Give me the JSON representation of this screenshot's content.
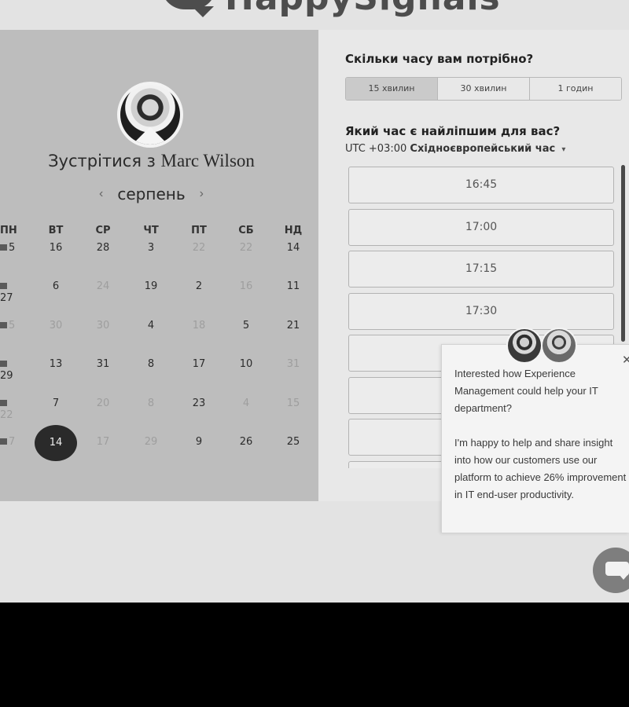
{
  "brand": {
    "name": "HappySignals",
    "logo_icon": "speech-bubble-logo"
  },
  "host": {
    "prefix": "Зустрітися з",
    "name": "Marc Wilson"
  },
  "calendar": {
    "month": "серпень",
    "prev_icon": "‹",
    "next_icon": "›",
    "weekdays": [
      "ПН",
      "ВТ",
      "СР",
      "ЧТ",
      "ПТ",
      "СБ",
      "НД"
    ],
    "weeks": [
      [
        {
          "d": "5",
          "dim": false
        },
        {
          "d": "16",
          "dim": false
        },
        {
          "d": "28",
          "dim": false
        },
        {
          "d": "3",
          "dim": false
        },
        {
          "d": "22",
          "dim": true
        },
        {
          "d": "22",
          "dim": true
        },
        {
          "d": "14",
          "dim": false
        }
      ],
      [
        {
          "d": "27",
          "dim": false
        },
        {
          "d": "6",
          "dim": false
        },
        {
          "d": "24",
          "dim": true
        },
        {
          "d": "19",
          "dim": false
        },
        {
          "d": "2",
          "dim": false
        },
        {
          "d": "16",
          "dim": true
        },
        {
          "d": "11",
          "dim": false
        }
      ],
      [
        {
          "d": "5",
          "dim": true
        },
        {
          "d": "30",
          "dim": true
        },
        {
          "d": "30",
          "dim": true
        },
        {
          "d": "4",
          "dim": false
        },
        {
          "d": "18",
          "dim": true
        },
        {
          "d": "5",
          "dim": false
        },
        {
          "d": "21",
          "dim": false
        }
      ],
      [
        {
          "d": "29",
          "dim": false
        },
        {
          "d": "13",
          "dim": false
        },
        {
          "d": "31",
          "dim": false
        },
        {
          "d": "8",
          "dim": false
        },
        {
          "d": "17",
          "dim": false
        },
        {
          "d": "10",
          "dim": false
        },
        {
          "d": "31",
          "dim": true
        }
      ],
      [
        {
          "d": "22",
          "dim": true
        },
        {
          "d": "7",
          "dim": false
        },
        {
          "d": "20",
          "dim": true
        },
        {
          "d": "8",
          "dim": true
        },
        {
          "d": "23",
          "dim": false
        },
        {
          "d": "4",
          "dim": true
        },
        {
          "d": "15",
          "dim": true
        }
      ],
      [
        {
          "d": "7",
          "dim": true
        },
        {
          "d": "14",
          "dim": false,
          "selected": true
        },
        {
          "d": "17",
          "dim": true
        },
        {
          "d": "29",
          "dim": true
        },
        {
          "d": "9",
          "dim": false
        },
        {
          "d": "26",
          "dim": false
        },
        {
          "d": "25",
          "dim": false
        }
      ]
    ]
  },
  "scheduler": {
    "duration_question": "Скільки часу вам потрібно?",
    "durations": [
      {
        "label": "15 хвилин",
        "active": true
      },
      {
        "label": "30 хвилин",
        "active": false
      },
      {
        "label": "1 годин",
        "active": false
      }
    ],
    "time_question": "Який час є найліпшим для вас?",
    "timezone_offset": "UTC +03:00",
    "timezone_name": "Східноєвропейський час",
    "timezone_caret": "▾",
    "slots": [
      "16:45",
      "17:00",
      "17:15",
      "17:30",
      "",
      "",
      "",
      ""
    ]
  },
  "chat_popup": {
    "close_icon": "✕",
    "paragraph1": "Interested how Experience Management could help your IT department?",
    "paragraph2": "I'm happy to help and share insight into how our customers use our platform to achieve 26% improvement in IT end-user productivity."
  },
  "chat_launcher": {
    "icon": "chat-bubble-icon"
  }
}
